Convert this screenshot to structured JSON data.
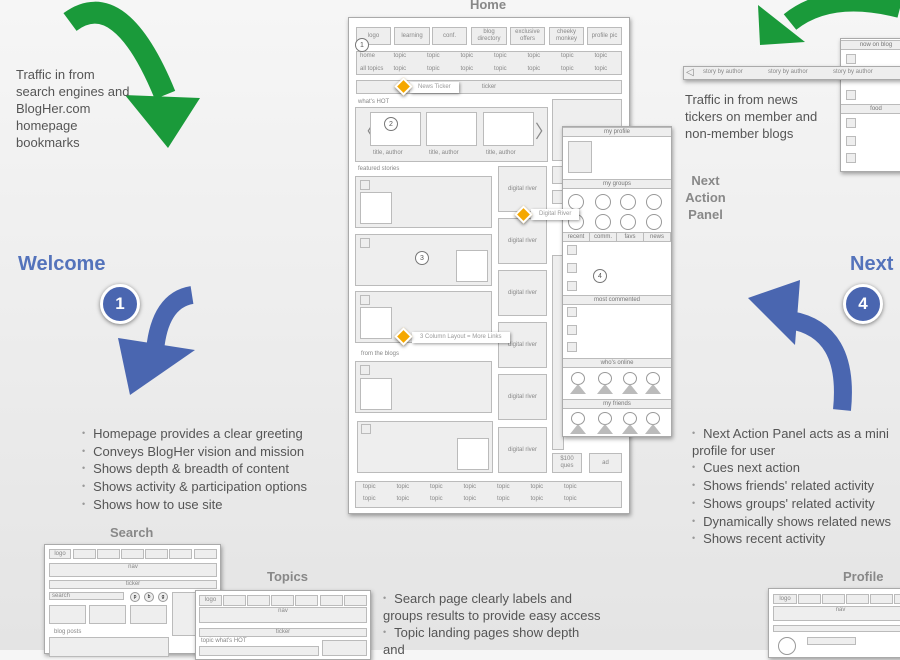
{
  "colors": {
    "green_arrow": "#1a9a3a",
    "blue_arrow": "#4a66b0",
    "callout": "#f5a800",
    "heading_blue": "#5473bb"
  },
  "left": {
    "traffic_text": "Traffic in from search engines and BlogHer.com homepage bookmarks",
    "welcome": "Welcome",
    "step": "1",
    "bullets": [
      "Homepage provides a clear greeting",
      "Conveys BlogHer vision and mission",
      "Shows depth & breadth of content",
      "Shows activity & participation options",
      "Shows how to use site"
    ]
  },
  "right": {
    "traffic_text": "Traffic in from news tickers on member and non-member blogs",
    "panel_label": "Next Action Panel",
    "next": "Next",
    "step": "4",
    "ticker_items": [
      "story by author",
      "story by author",
      "story by author"
    ],
    "panel_headers": [
      "now on blog",
      "food"
    ],
    "bullets": [
      "Next Action Panel acts as a mini profile for user",
      "Cues next action",
      "Shows friends' related activity",
      "Shows groups' related activity",
      "Dynamically shows related news",
      "Shows recent activity"
    ]
  },
  "home": {
    "title": "Home",
    "nav": [
      "logo",
      "learning",
      "conf.",
      "blog directory",
      "exclusive offers",
      "cheeky monkey",
      "profile pic"
    ],
    "topics_row1": [
      "home",
      "topic",
      "topic",
      "topic",
      "topic",
      "topic",
      "topic",
      "topic"
    ],
    "topics_row2": [
      "all topics",
      "topic",
      "topic",
      "topic",
      "topic",
      "topic",
      "topic",
      "topic"
    ],
    "ticker": "ticker",
    "whats_hot": "what's HOT",
    "caption": "title, author",
    "featured": "featured stories",
    "from_blogs": "from the blogs",
    "digital_river": "digital river",
    "ques": "$100 ques",
    "ad": "ad",
    "bottom_topics": [
      "topic",
      "topic",
      "topic",
      "topic",
      "topic",
      "topic",
      "topic"
    ],
    "steps": [
      "1",
      "2",
      "3",
      "4"
    ],
    "callouts": {
      "news": "News Ticker",
      "dr": "Digital River",
      "layout": "3 Column Layout = More Links"
    },
    "panel": {
      "my_profile": "my profile",
      "my_groups": "my groups",
      "tabs": [
        "recent",
        "comm.",
        "favs",
        "news"
      ],
      "most_commented": "most commented",
      "whos_online": "who's online",
      "my_friends": "my friends"
    }
  },
  "search": {
    "title": "Search",
    "logo": "logo",
    "nav": "nav",
    "ticker": "ticker",
    "search": "search",
    "buttons": [
      "p",
      "b",
      "g"
    ],
    "blog_posts": "blog posts"
  },
  "topics": {
    "title": "Topics",
    "logo": "logo",
    "nav": "nav",
    "ticker": "ticker",
    "whats_hot": "topic what's HOT",
    "bullets": [
      "Search page clearly labels and groups results to provide easy access",
      "Topic landing pages show depth and"
    ]
  },
  "profile": {
    "title": "Profile",
    "logo": "logo",
    "nav": "nav"
  }
}
